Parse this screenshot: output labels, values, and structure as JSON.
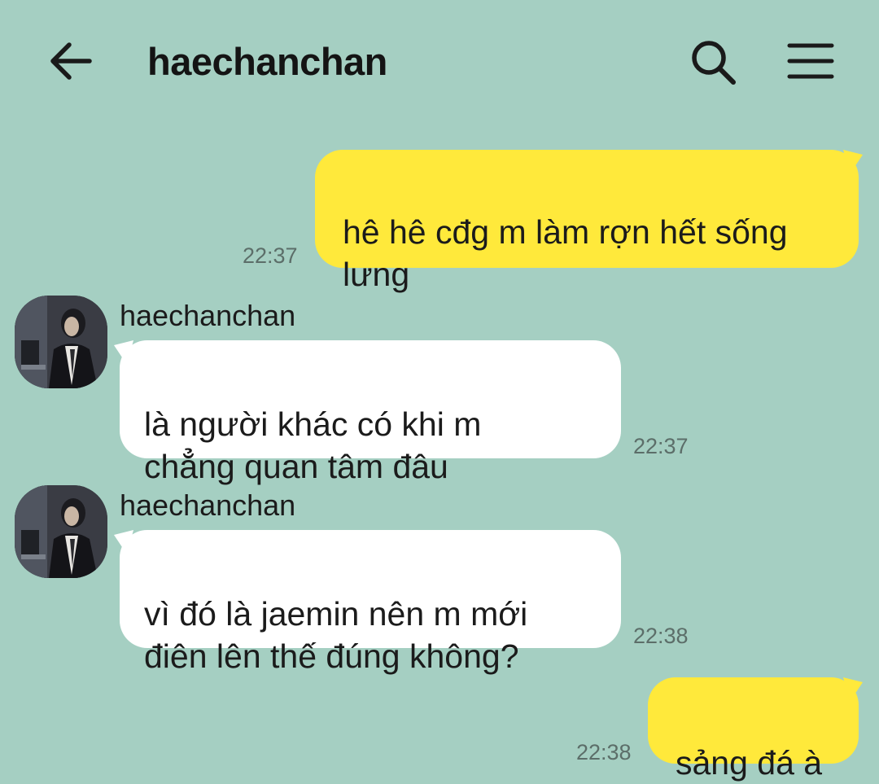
{
  "header": {
    "title": "haechanchan",
    "back_icon": "arrow-left-icon",
    "search_icon": "search-icon",
    "menu_icon": "hamburger-menu-icon"
  },
  "colors": {
    "background": "#a5cfc2",
    "outgoing_bubble": "#ffe93b",
    "incoming_bubble": "#ffffff"
  },
  "messages": [
    {
      "direction": "outgoing",
      "text": "hê hê cđg m làm rợn hết sống\nlưng",
      "time": "22:37"
    },
    {
      "direction": "incoming",
      "sender": "haechanchan",
      "text": "là người khác có khi m\nchẳng quan tâm đâu",
      "time": "22:37"
    },
    {
      "direction": "incoming",
      "sender": "haechanchan",
      "text": "vì đó là jaemin nên m mới\nđiên lên thế đúng không?",
      "time": "22:38"
    },
    {
      "direction": "outgoing",
      "text": "sảng đá à",
      "time": "22:38"
    }
  ]
}
